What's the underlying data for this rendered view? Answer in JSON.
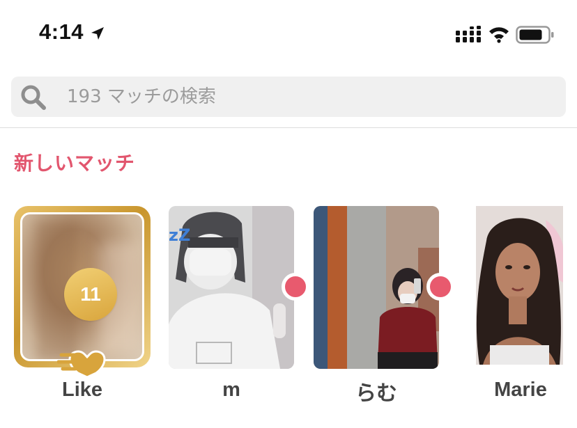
{
  "status_bar": {
    "time": "4:14",
    "icons": [
      "location-arrow-icon",
      "cellular-signal-icon",
      "wifi-icon",
      "battery-icon"
    ]
  },
  "search": {
    "placeholder": "193 マッチの検索",
    "value": ""
  },
  "section": {
    "title": "新しいマッチ"
  },
  "matches": [
    {
      "type": "likes",
      "label": "Like",
      "count": "11",
      "icon": "gold-heart-icon"
    },
    {
      "type": "match",
      "label": "m",
      "new": true
    },
    {
      "type": "match",
      "label": "らむ",
      "new": true
    },
    {
      "type": "match",
      "label": "Marie",
      "new": false
    }
  ],
  "colors": {
    "accent": "#e2566e",
    "new_dot": "#e85a6e",
    "gold": "#d9a53c",
    "search_bg": "#f0f0f0"
  }
}
